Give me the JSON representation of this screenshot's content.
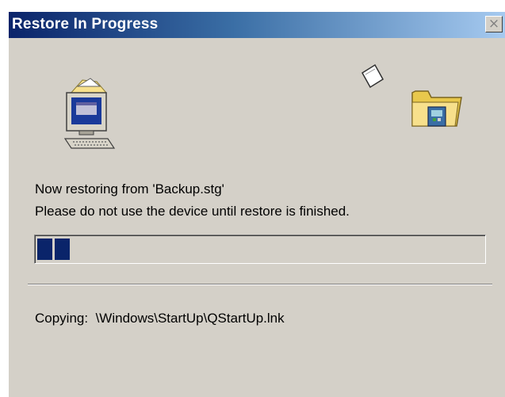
{
  "window": {
    "title": "Restore In Progress",
    "close_glyph": "×"
  },
  "icons": {
    "source": "computer-icon",
    "transfer": "flying-paper-icon",
    "destination": "folder-icon"
  },
  "status": {
    "line1": "Now restoring from 'Backup.stg'",
    "line2": "Please do not use the device until restore is finished."
  },
  "progress": {
    "percent": 8,
    "fill_color": "#0a246a"
  },
  "copying": {
    "label": "Copying:",
    "path": "\\Windows\\StartUp\\QStartUp.lnk"
  },
  "colors": {
    "face": "#d4d0c8",
    "title_start": "#0a246a",
    "title_end": "#a6caf0"
  }
}
